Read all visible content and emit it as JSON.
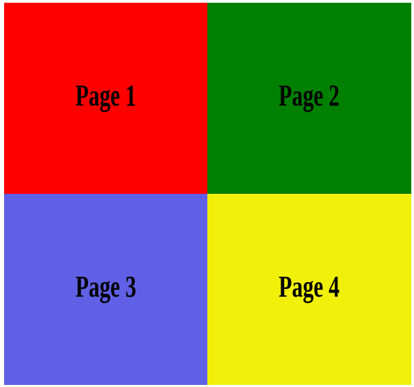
{
  "tiles": [
    {
      "label": "Page 1",
      "color": "#ff0000"
    },
    {
      "label": "Page 2",
      "color": "#008000"
    },
    {
      "label": "Page 3",
      "color": "#6060e6"
    },
    {
      "label": "Page 4",
      "color": "#f0f00a"
    }
  ]
}
